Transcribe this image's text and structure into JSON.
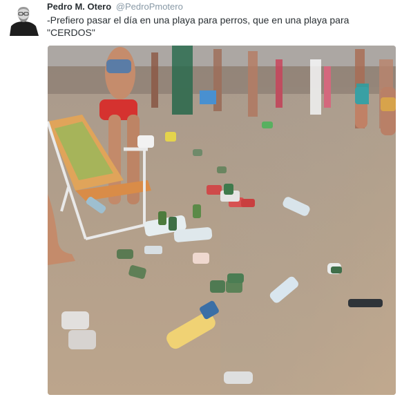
{
  "tweet": {
    "fullname": "Pedro M. Otero",
    "handle": "@PedroPmotero",
    "text": "-Prefiero pasar el día en una playa para perros, que en una playa para \"CERDOS\""
  },
  "avatar": {
    "icon": "user-avatar-portrait"
  },
  "photo": {
    "subject": "beach-littered-with-cans-and-bottles",
    "colors": {
      "sand": "#b8a18a",
      "wet_sand": "#a89a8d",
      "sky": "#d9dde0"
    }
  }
}
